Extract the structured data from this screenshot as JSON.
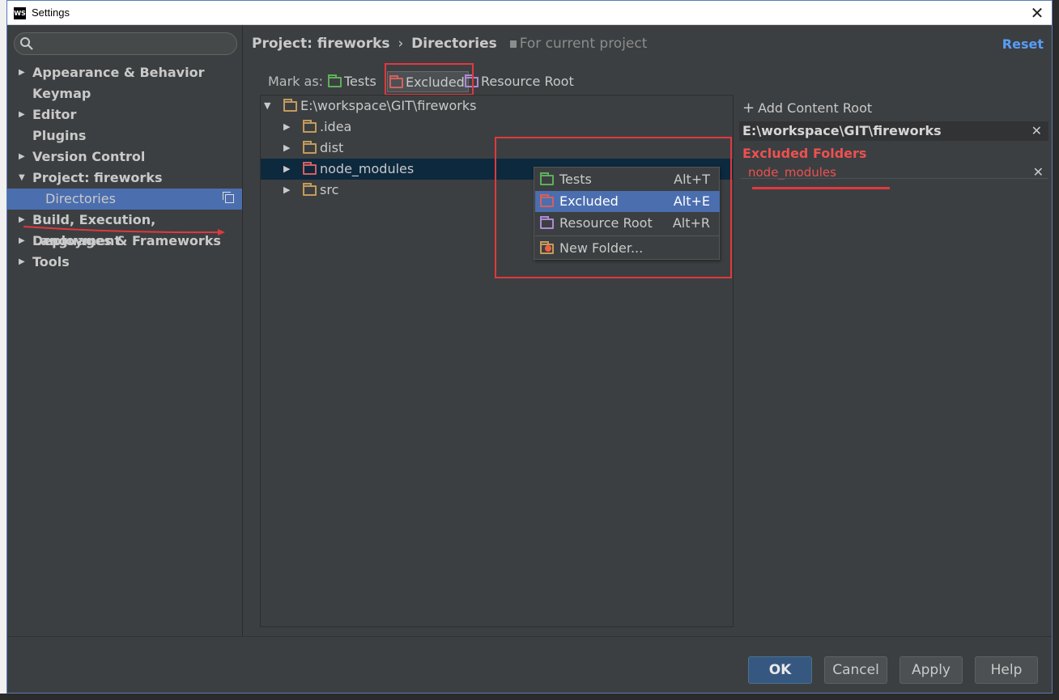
{
  "window": {
    "title": "Settings",
    "app_icon_text": "WS",
    "close_glyph": "✕"
  },
  "sidebar": {
    "search_placeholder": "",
    "items": [
      {
        "label": "Appearance & Behavior",
        "arrow": "▶"
      },
      {
        "label": "Keymap",
        "arrow": ""
      },
      {
        "label": "Editor",
        "arrow": "▶"
      },
      {
        "label": "Plugins",
        "arrow": ""
      },
      {
        "label": "Version Control",
        "arrow": "▶"
      },
      {
        "label": "Project: fireworks",
        "arrow": "▼"
      },
      {
        "label": "Directories",
        "arrow": ""
      },
      {
        "label": "Build, Execution, Deployment",
        "arrow": "▶"
      },
      {
        "label": "Languages & Frameworks",
        "arrow": "▶"
      },
      {
        "label": "Tools",
        "arrow": "▶"
      }
    ]
  },
  "main": {
    "breadcrumb_project": "Project: fireworks",
    "breadcrumb_sep": "›",
    "breadcrumb_page": "Directories",
    "scope": "For current project",
    "reset": "Reset",
    "mark_as_label": "Mark as:",
    "mark_buttons": [
      {
        "label": "Tests",
        "color": "#5fae5b"
      },
      {
        "label": "Excluded",
        "color": "#d4605f"
      },
      {
        "label": "Resource Root",
        "color": "#ad8ad5"
      }
    ]
  },
  "tree": {
    "rows": [
      {
        "label": "E:\\workspace\\GIT\\fireworks",
        "toggle": "▼",
        "folder": "tan"
      },
      {
        "label": ".idea",
        "toggle": "▶",
        "folder": "tan"
      },
      {
        "label": "dist",
        "toggle": "▶",
        "folder": "tan"
      },
      {
        "label": "node_modules",
        "toggle": "▶",
        "folder": "red"
      },
      {
        "label": "src",
        "toggle": "▶",
        "folder": "tan"
      }
    ]
  },
  "popup": {
    "items": [
      {
        "label": "Tests",
        "shortcut": "Alt+T"
      },
      {
        "label": "Excluded",
        "shortcut": "Alt+E"
      },
      {
        "label": "Resource Root",
        "shortcut": "Alt+R"
      },
      {
        "label": "New Folder...",
        "shortcut": ""
      }
    ]
  },
  "right_pane": {
    "add_content_root": "Add Content Root",
    "root_path": "E:\\workspace\\GIT\\fireworks",
    "excluded_title": "Excluded Folders",
    "excluded_items": [
      "node_modules"
    ],
    "remove_glyph": "✕"
  },
  "footer": {
    "ok": "OK",
    "cancel": "Cancel",
    "apply": "Apply",
    "help": "Help"
  },
  "colors": {
    "accent": "#4b6eaf",
    "link": "#589df6",
    "annotation": "#e0393e",
    "excluded_text": "#ee5050"
  }
}
